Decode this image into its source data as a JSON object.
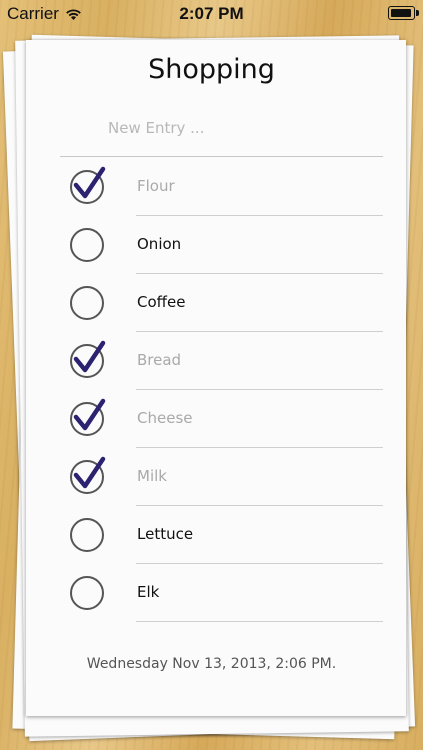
{
  "status_bar": {
    "carrier": "Carrier",
    "time": "2:07 PM",
    "battery_level": 1.0
  },
  "list": {
    "title": "Shopping",
    "new_entry_placeholder": "New Entry ...",
    "items": [
      {
        "label": "Flour",
        "checked": true
      },
      {
        "label": "Onion",
        "checked": false
      },
      {
        "label": "Coffee",
        "checked": false
      },
      {
        "label": "Bread",
        "checked": true
      },
      {
        "label": "Cheese",
        "checked": true
      },
      {
        "label": "Milk",
        "checked": true
      },
      {
        "label": "Lettuce",
        "checked": false
      },
      {
        "label": "Elk",
        "checked": false
      }
    ],
    "timestamp": "Wednesday Nov 13, 2013, 2:06 PM."
  },
  "colors": {
    "checkmark": "#2b2270",
    "circle": "#555555",
    "done_text": "#a9a9a9",
    "todo_text": "#111111"
  }
}
